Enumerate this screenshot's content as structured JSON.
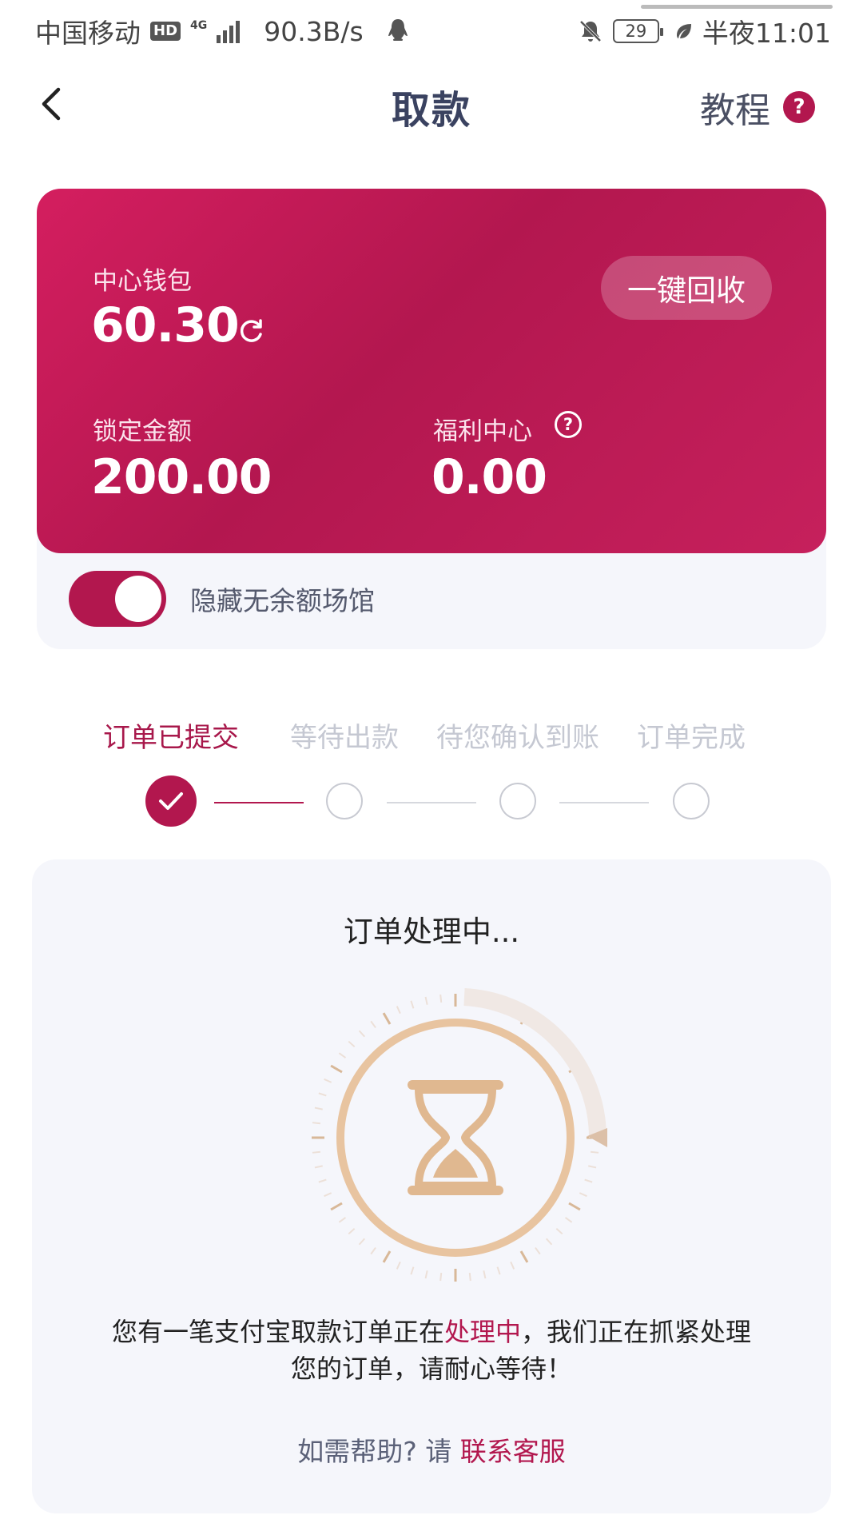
{
  "status_bar": {
    "carrier": "中国移动",
    "hd": "HD",
    "network": "4G",
    "speed": "90.3B/s",
    "battery": "29",
    "time": "半夜11:01"
  },
  "header": {
    "title": "取款",
    "tutorial": "教程",
    "tutorial_help": "?"
  },
  "wallet": {
    "center_label": "中心钱包",
    "center_value": "60.30",
    "recycle_button": "一键回收",
    "locked_label": "锁定金额",
    "locked_value": "200.00",
    "welfare_label": "福利中心",
    "welfare_help": "?",
    "welfare_value": "0.00",
    "toggle_label": "隐藏无余额场馆",
    "toggle_on": true
  },
  "steps": [
    {
      "label": "订单已提交",
      "done": true
    },
    {
      "label": "等待出款",
      "done": false
    },
    {
      "label": "待您确认到账",
      "done": false
    },
    {
      "label": "订单完成",
      "done": false
    }
  ],
  "processing": {
    "title": "订单处理中...",
    "message_part1": "您有一笔支付宝取款订单正在",
    "message_highlight": "处理中",
    "message_part2": "，我们正在抓紧处理",
    "message_line2": "您的订单，请耐心等待！",
    "help_prefix": "如需帮助? 请 ",
    "help_link": "联系客服"
  },
  "colors": {
    "accent": "#b2174e",
    "timer": "#e8c4a0"
  }
}
